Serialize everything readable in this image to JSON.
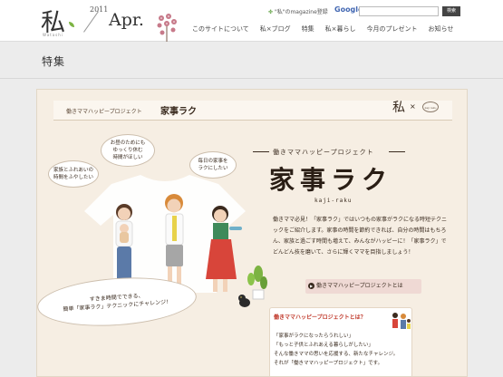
{
  "header": {
    "logo_kanji": "私",
    "logo_sub": "Watashi",
    "year": "2011",
    "month": "Apr.",
    "magazine_link": "\"私\"のmagazine登録",
    "google_label": "Google",
    "search_button": "検索",
    "nav": [
      {
        "label": "このサイトについて"
      },
      {
        "label": "私×ブログ"
      },
      {
        "label": "特集"
      },
      {
        "label": "私×暮らし"
      },
      {
        "label": "今月のプレゼント"
      },
      {
        "label": "お知らせ"
      }
    ]
  },
  "section": {
    "title": "特集"
  },
  "panel": {
    "header_sub": "働きママハッピープロジェクト",
    "header_title": "家事ラク",
    "brand": "私",
    "brand_x": "×",
    "brand_circle": "kaji raku"
  },
  "illustration": {
    "bubble1": [
      "お昼のためにも",
      "ゆっくり休む",
      "時間がほしい"
    ],
    "bubble2": [
      "家族とふれあいの",
      "時間をふやしたい"
    ],
    "bubble3": [
      "毎日の家事を",
      "ラクにしたい"
    ],
    "bottom_bubble": [
      "すきま時間でできる、",
      "簡単「家事ラク」テクニックにチャレンジ！"
    ]
  },
  "feature": {
    "project_label": "働きママハッピープロジェクト",
    "title": "家事ラク",
    "romaji": "kaji-raku",
    "description": "働きママ必見！「家事ラク」ではいつもの家事がラクになる時短テクニックをご紹介します。家事の時間を節約できれば、自分の時間はもちろん、家族と過ごす時間も増えて、みんながハッピーに！「家事ラク」でどんどん技を磨いて、さらに輝くママを目指しましょう！",
    "about_button": "働きママハッピープロジェクトとは",
    "about_icon": "arrow"
  },
  "card": {
    "title": "働きママハッピープロジェクトとは？",
    "lines": [
      "「家事がラクになったらうれしい」",
      "「もっと子供とふれあえる暮らしがしたい」",
      "そんな働きママの思いを応援する、新たなチャレンジ。",
      "それが「働きママハッピープロジェクト」です。"
    ]
  }
}
